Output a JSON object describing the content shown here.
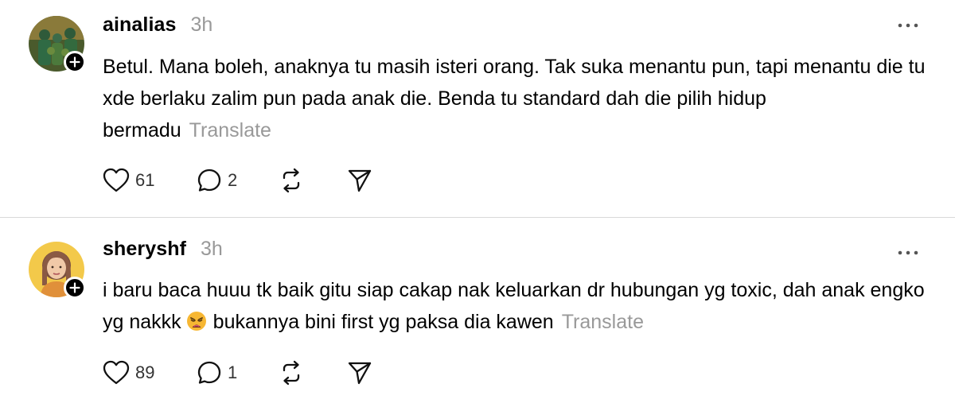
{
  "posts": [
    {
      "username": "ainalias",
      "time": "3h",
      "text": "Betul. Mana boleh, anaknya tu masih isteri orang. Tak suka menantu pun, tapi menantu die tu xde berlaku zalim pun pada anak die. Benda tu standard dah die pilih hidup bermadu",
      "translate_label": "Translate",
      "likes": "61",
      "replies": "2"
    },
    {
      "username": "sheryshf",
      "time": "3h",
      "text_before_emoji": "i baru baca huuu tk baik gitu siap cakap nak keluarkan dr hubungan yg toxic, dah anak engko yg nakkk",
      "text_after_emoji": "bukannya bini first yg paksa dia kawen",
      "emoji": "weary-face",
      "translate_label": "Translate",
      "likes": "89",
      "replies": "1"
    }
  ],
  "icons": {
    "like": "heart-icon",
    "reply": "comment-icon",
    "repost": "repost-icon",
    "share": "send-icon",
    "more": "more-icon",
    "follow": "plus-icon"
  },
  "colors": {
    "text": "#000000",
    "muted": "#999999",
    "divider": "#d9d9d9"
  }
}
